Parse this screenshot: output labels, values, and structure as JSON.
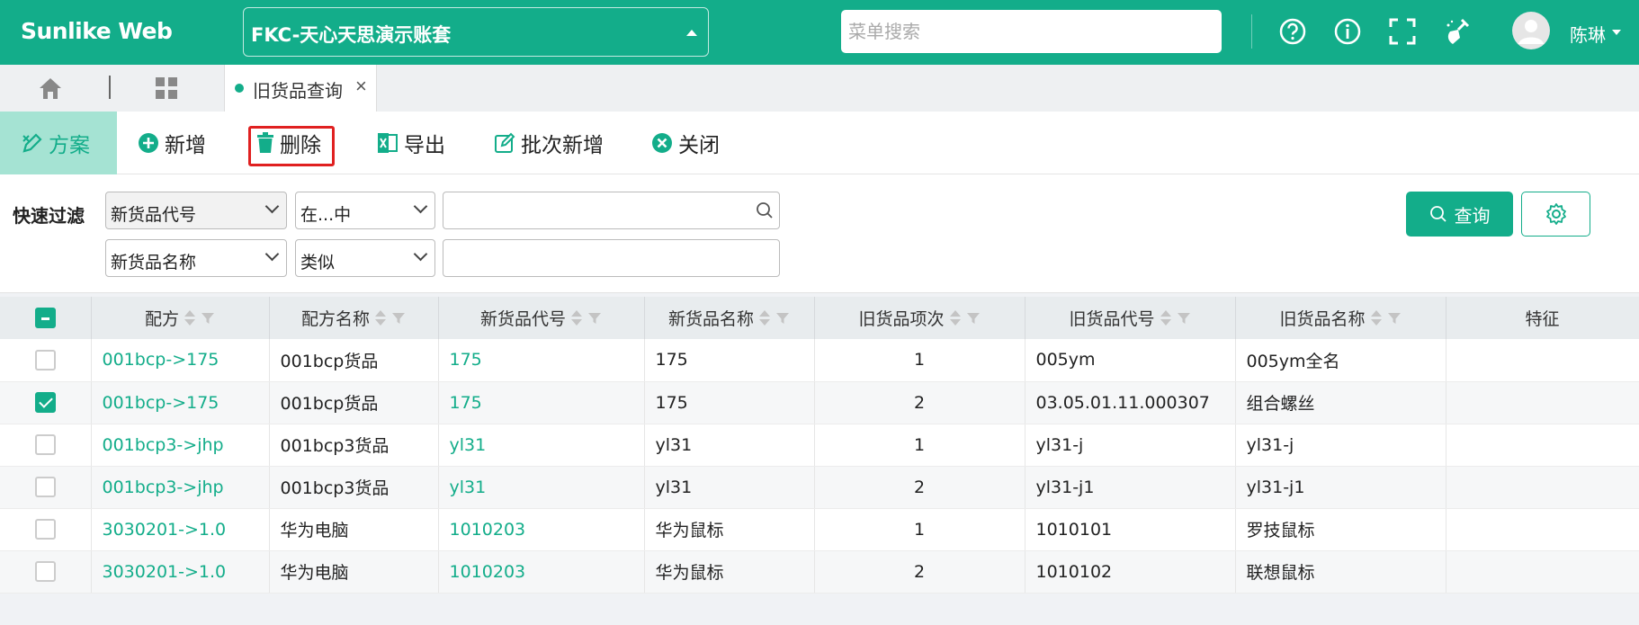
{
  "app": {
    "logo": "Sunlike Web",
    "account": "FKC-天心天思演示账套",
    "search_placeholder": "菜单搜索",
    "user_name": "陈琳"
  },
  "tabs": {
    "active_label": "旧货品查询",
    "close_glyph": "×"
  },
  "toolbar": {
    "plan": "方案",
    "add": "新增",
    "delete": "删除",
    "export": "导出",
    "batch_add": "批次新增",
    "close": "关闭"
  },
  "filter": {
    "label": "快速过滤",
    "row1": {
      "field": "新货品代号",
      "op": "在...中",
      "value": ""
    },
    "row2": {
      "field": "新货品名称",
      "op": "类似",
      "value": ""
    },
    "query_button": "查询"
  },
  "table": {
    "columns": [
      "配方",
      "配方名称",
      "新货品代号",
      "新货品名称",
      "旧货品项次",
      "旧货品代号",
      "旧货品名称",
      "特征"
    ],
    "rows": [
      {
        "checked": false,
        "cells": [
          "001bcp->175",
          "001bcp货品",
          "175",
          "175",
          "1",
          "005ym",
          "005ym全名",
          ""
        ]
      },
      {
        "checked": true,
        "cells": [
          "001bcp->175",
          "001bcp货品",
          "175",
          "175",
          "2",
          "03.05.01.11.000307",
          "组合螺丝",
          ""
        ]
      },
      {
        "checked": false,
        "cells": [
          "001bcp3->jhp",
          "001bcp3货品",
          "yl31",
          "yl31",
          "1",
          "yl31-j",
          "yl31-j",
          ""
        ]
      },
      {
        "checked": false,
        "cells": [
          "001bcp3->jhp",
          "001bcp3货品",
          "yl31",
          "yl31",
          "2",
          "yl31-j1",
          "yl31-j1",
          ""
        ]
      },
      {
        "checked": false,
        "cells": [
          "3030201->1.0",
          "华为电脑",
          "1010203",
          "华为鼠标",
          "1",
          "1010101",
          "罗技鼠标",
          ""
        ]
      },
      {
        "checked": false,
        "cells": [
          "3030201->1.0",
          "华为电脑",
          "1010203",
          "华为鼠标",
          "2",
          "1010102",
          "联想鼠标",
          ""
        ]
      }
    ]
  },
  "colors": {
    "brand": "#13ad8a",
    "plan_bg": "#a5e3d3",
    "highlight_border": "#e02020"
  }
}
